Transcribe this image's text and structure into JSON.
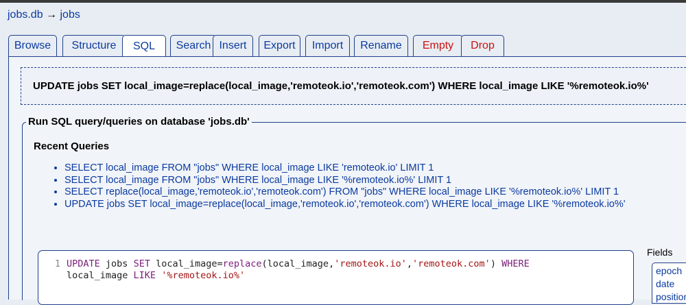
{
  "breadcrumb": {
    "db": "jobs.db",
    "arrow": "→",
    "table": "jobs"
  },
  "tabs": [
    {
      "label": "Browse",
      "type": "normal"
    },
    {
      "label": "Structure",
      "type": "normal"
    },
    {
      "label": "SQL",
      "type": "active"
    },
    {
      "label": "Search",
      "type": "normal"
    },
    {
      "label": "Insert",
      "type": "normal"
    },
    {
      "label": "Export",
      "type": "normal"
    },
    {
      "label": "Import",
      "type": "normal"
    },
    {
      "label": "Rename",
      "type": "normal"
    },
    {
      "label": "Empty",
      "type": "danger"
    },
    {
      "label": "Drop",
      "type": "danger"
    }
  ],
  "executed_query": "UPDATE jobs SET local_image=replace(local_image,'remoteok.io','remoteok.com') WHERE local_image LIKE '%remoteok.io%'",
  "run_section": {
    "legend": "Run SQL query/queries on database 'jobs.db'",
    "recent_title": "Recent Queries",
    "recent_queries": [
      "SELECT local_image FROM \"jobs\" WHERE local_image LIKE 'remoteok.io' LIMIT 1",
      "SELECT local_image FROM \"jobs\" WHERE local_image LIKE '%remoteok.io%' LIMIT 1",
      "SELECT replace(local_image,'remoteok.io','remoteok.com') FROM \"jobs\" WHERE local_image LIKE '%remoteok.io%' LIMIT 1",
      "UPDATE jobs SET local_image=replace(local_image,'remoteok.io','remoteok.com') WHERE local_image LIKE '%remoteok.io%'"
    ]
  },
  "editor": {
    "line_number": "1",
    "tokens_line1": [
      {
        "t": "UPDATE",
        "c": "kw"
      },
      {
        "t": " jobs ",
        "c": ""
      },
      {
        "t": "SET",
        "c": "kw"
      },
      {
        "t": " local_image=",
        "c": ""
      },
      {
        "t": "replace",
        "c": "fn"
      },
      {
        "t": "(local_image,",
        "c": ""
      },
      {
        "t": "'remoteok.io'",
        "c": "str"
      },
      {
        "t": ",",
        "c": ""
      },
      {
        "t": "'remoteok.com'",
        "c": "str"
      },
      {
        "t": ") ",
        "c": ""
      },
      {
        "t": "WHERE",
        "c": "kw"
      }
    ],
    "tokens_line2": [
      {
        "t": "local_image ",
        "c": ""
      },
      {
        "t": "LIKE",
        "c": "kw"
      },
      {
        "t": " ",
        "c": ""
      },
      {
        "t": "'%remoteok.io%'",
        "c": "str"
      }
    ]
  },
  "fields": {
    "label": "Fields",
    "items": [
      "epoch",
      "date",
      "position"
    ]
  }
}
